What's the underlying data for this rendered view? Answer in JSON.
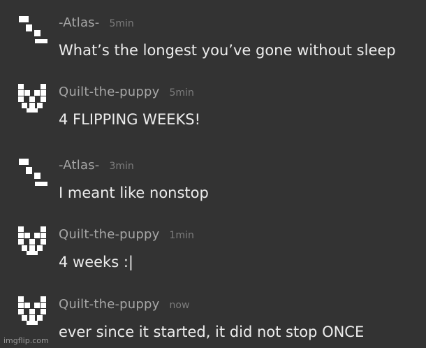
{
  "messages": [
    {
      "username": "-Atlas-",
      "timestamp": "5min",
      "text": "What’s the longest you’ve gone without sleep",
      "avatar_icon": "pixel-atlas-avatar"
    },
    {
      "username": "Quilt-the-puppy",
      "timestamp": "5min",
      "text": "4 FLIPPING WEEKS!",
      "avatar_icon": "pixel-cat-avatar"
    },
    {
      "username": "-Atlas-",
      "timestamp": "3min",
      "text": "I meant like nonstop",
      "avatar_icon": "pixel-atlas-avatar"
    },
    {
      "username": "Quilt-the-puppy",
      "timestamp": "1min",
      "text": "4 weeks :|",
      "avatar_icon": "pixel-cat-avatar"
    },
    {
      "username": "Quilt-the-puppy",
      "timestamp": "now",
      "text": "ever since it started, it did not stop ONCE",
      "avatar_icon": "pixel-cat-avatar"
    }
  ],
  "watermark": "imgflip.com",
  "colors": {
    "background": "#333333",
    "username": "#a6a6a6",
    "timestamp": "#7d7d7d",
    "message_text": "#ececec"
  }
}
